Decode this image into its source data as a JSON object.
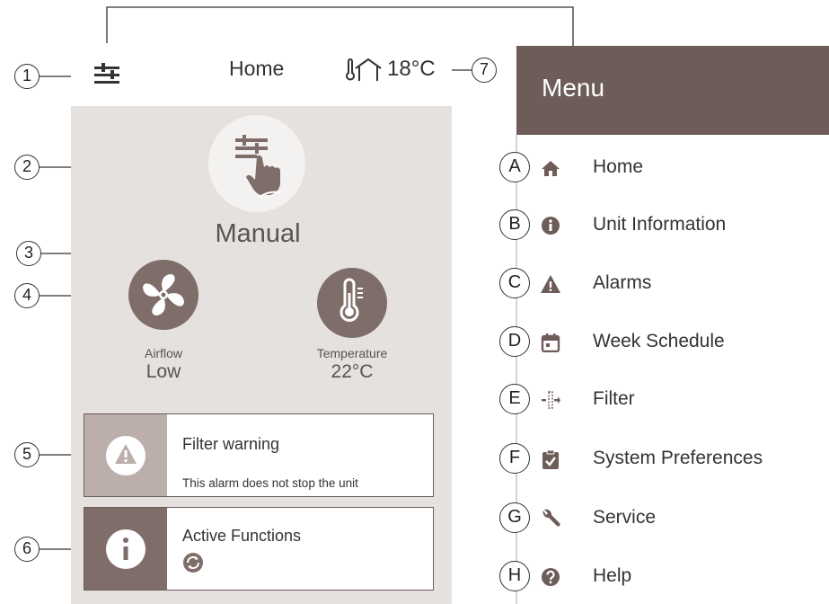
{
  "screen": {
    "topbar": {
      "title": "Home",
      "outdoor_temperature": "18°C"
    },
    "mode": {
      "label": "Manual"
    },
    "airflow": {
      "label": "Airflow",
      "value": "Low"
    },
    "temperature": {
      "label": "Temperature",
      "value": "22°C"
    },
    "alarm_card": {
      "title": "Filter warning",
      "subtitle": "This alarm does not stop the unit"
    },
    "functions_card": {
      "title": "Active Functions"
    }
  },
  "callouts": [
    "1",
    "2",
    "3",
    "4",
    "5",
    "6",
    "7"
  ],
  "menu": {
    "title": "Menu",
    "items": [
      {
        "letter": "A",
        "label": "Home",
        "icon": "home-icon"
      },
      {
        "letter": "B",
        "label": "Unit Information",
        "icon": "info-icon"
      },
      {
        "letter": "C",
        "label": "Alarms",
        "icon": "warning-icon"
      },
      {
        "letter": "D",
        "label": "Week Schedule",
        "icon": "calendar-icon"
      },
      {
        "letter": "E",
        "label": "Filter",
        "icon": "filter-icon"
      },
      {
        "letter": "F",
        "label": "System Preferences",
        "icon": "clipboard-check-icon"
      },
      {
        "letter": "G",
        "label": "Service",
        "icon": "wrench-icon"
      },
      {
        "letter": "H",
        "label": "Help",
        "icon": "help-icon"
      }
    ]
  },
  "colors": {
    "accent_brown": "#7f6d69",
    "menu_header": "#6d5c58",
    "screen_background": "#e5e1de",
    "alarm_panel": "#bcaeab",
    "info_panel": "#7f6d69"
  }
}
